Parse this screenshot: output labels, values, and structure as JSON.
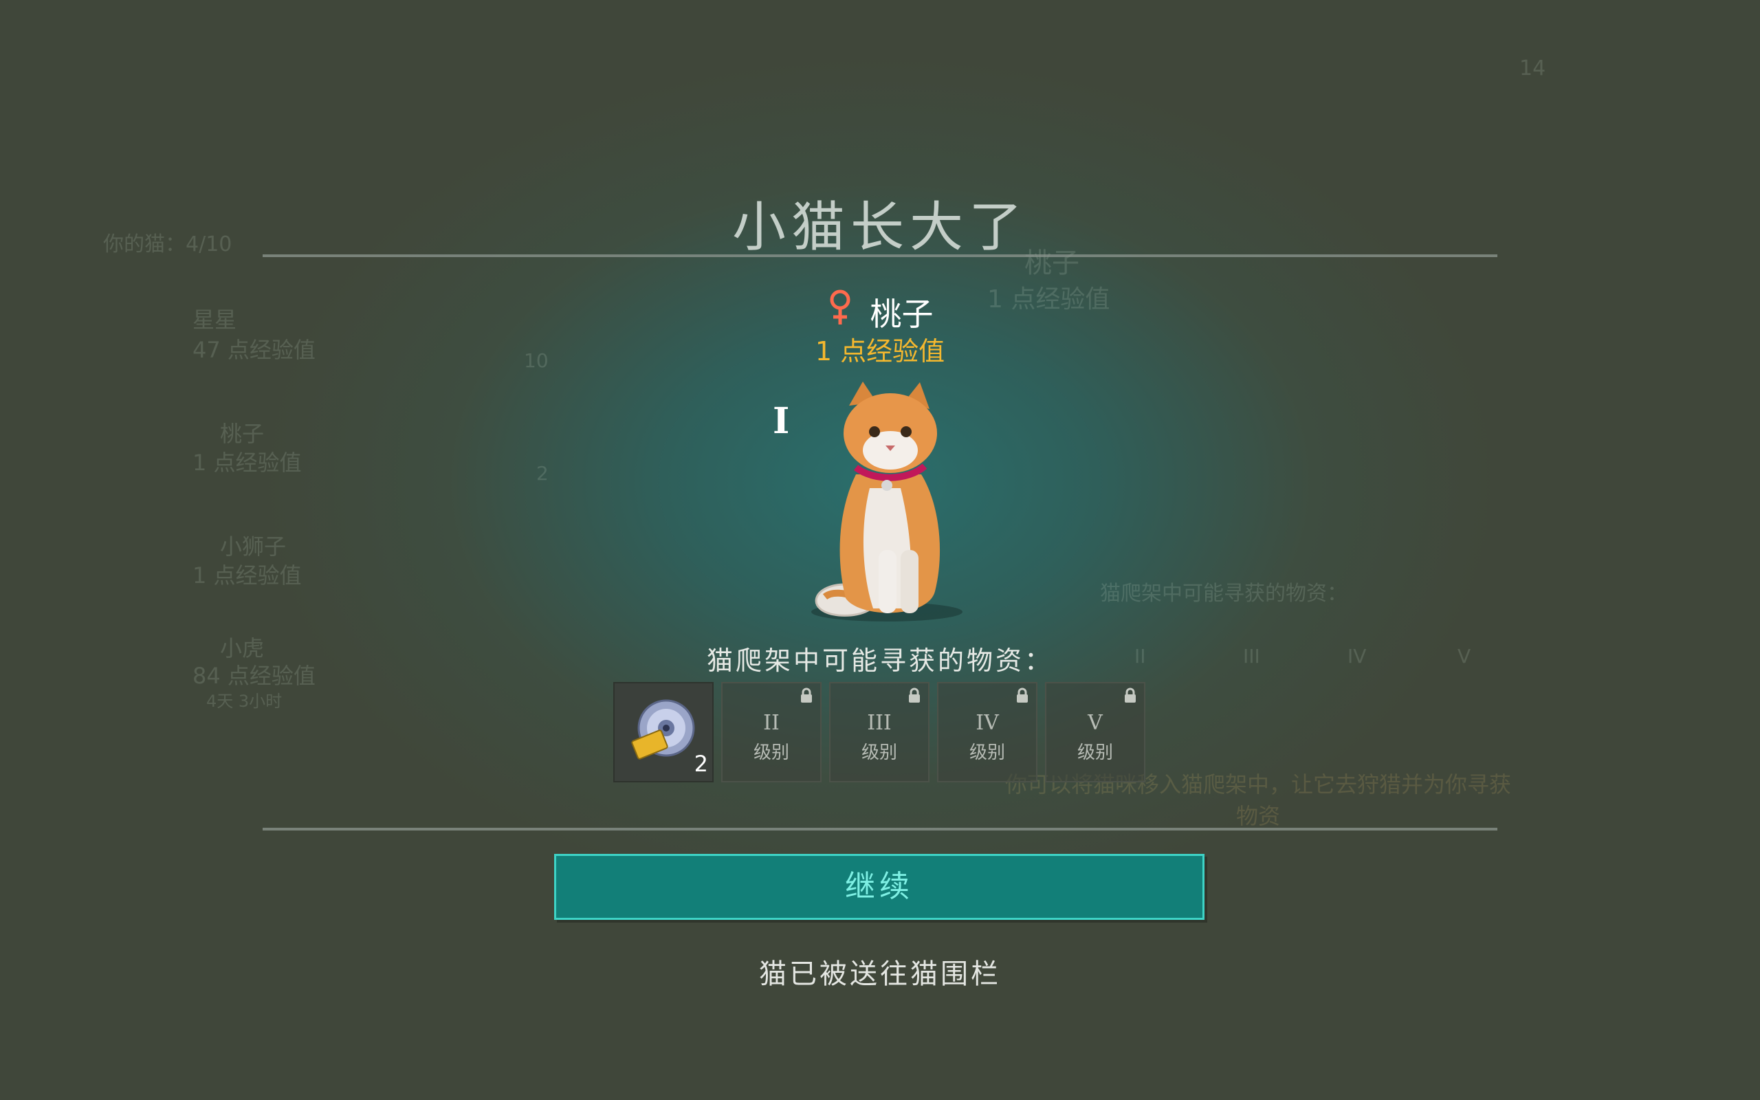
{
  "dialog": {
    "title": "小猫长大了",
    "cat_name": "桃子",
    "cat_gender_icon": "female-icon",
    "cat_exp": "1 点经验值",
    "loot_title": "猫爬架中可能寻获的物资：",
    "slots": [
      {
        "icon": "disc-item-icon",
        "count": "2",
        "locked": false
      },
      {
        "roman": "II",
        "level_label": "级别",
        "locked": true
      },
      {
        "roman": "III",
        "level_label": "级别",
        "locked": true
      },
      {
        "roman": "IV",
        "level_label": "级别",
        "locked": true
      },
      {
        "roman": "V",
        "level_label": "级别",
        "locked": true
      }
    ],
    "continue_label": "继续",
    "status_text": "猫已被送往猫围栏"
  },
  "background": {
    "header_count": "你的猫：4/10",
    "top_right_number": "14",
    "cats": [
      {
        "name": "星星",
        "exp": "47 点经验值",
        "item_count": "10"
      },
      {
        "name": "桃子",
        "exp": "1 点经验值",
        "item_count": "2"
      },
      {
        "name": "小狮子",
        "exp": "1 点经验值"
      },
      {
        "name": "小虎",
        "exp": "84 点经验值",
        "timer": "4天 3小时"
      }
    ],
    "detail": {
      "name": "桃子",
      "exp": "1 点经验值",
      "loot_title": "猫爬架中可能寻获的物资：",
      "levels": [
        "II",
        "III",
        "IV",
        "V"
      ],
      "level_label": "级别",
      "hint": "你可以将猫咪移入猫爬架中，让它去狩猎并为你寻获物资"
    }
  },
  "colors": {
    "accent": "#127f78",
    "accent_border": "#3ed3c6",
    "exp_color": "#f5b82e",
    "female_color": "#ff6a4d"
  }
}
